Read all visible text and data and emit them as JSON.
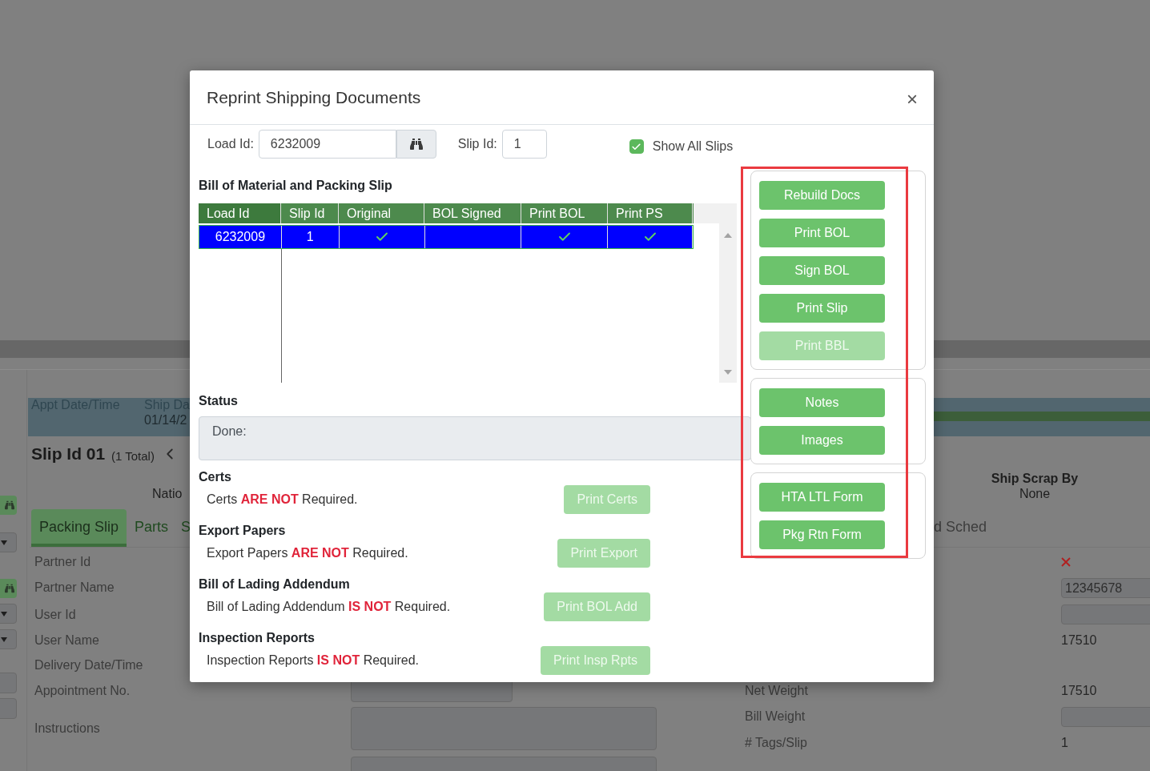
{
  "background": {
    "header_band": [
      {
        "label": "Appt Date/Time"
      },
      {
        "label": "Ship Da",
        "value": "01/14/2"
      }
    ],
    "slip_title": "Slip Id 01",
    "slip_total": "(1 Total)",
    "partial_label": "Natio",
    "tabs": [
      {
        "label": "Packing Slip",
        "selected": true
      },
      {
        "label": "Parts",
        "selected": false
      },
      {
        "label": "S",
        "selected": false
      }
    ],
    "tab_right": "d Sched",
    "ship_scrap": {
      "label": "Ship Scrap By",
      "value": "None"
    },
    "fields": [
      "Partner Id",
      "Partner Name",
      "User Id",
      "User Name",
      "Delivery Date/Time",
      "Appointment No.",
      "Instructions"
    ],
    "right_fields": [
      {
        "kind": "error"
      },
      {
        "kind": "input",
        "value": "12345678"
      },
      {
        "kind": "input"
      },
      {
        "kind": "text",
        "value": "17510"
      }
    ],
    "weights": [
      {
        "label": "Net Weight",
        "kind": "text",
        "value": "17510"
      },
      {
        "label": "Bill Weight",
        "kind": "input"
      },
      {
        "label": "# Tags/Slip",
        "kind": "text",
        "value": "1"
      }
    ]
  },
  "modal": {
    "title": "Reprint Shipping Documents",
    "close": "×",
    "load_id": {
      "label": "Load Id:",
      "value": "6232009"
    },
    "slip_id": {
      "label": "Slip Id:",
      "value": "1"
    },
    "show_all_slips": {
      "label": "Show All Slips",
      "checked": true
    },
    "table": {
      "title": "Bill of Material and Packing Slip",
      "columns": [
        "Load Id",
        "Slip Id",
        "Original",
        "BOL Signed",
        "Print BOL",
        "Print PS"
      ],
      "rows": [
        {
          "load_id": "6232009",
          "slip_id": "1",
          "original": true,
          "bol_signed": false,
          "print_bol": true,
          "print_ps": true,
          "selected": true
        }
      ]
    },
    "status": {
      "title": "Status",
      "text": "Done:"
    },
    "sections": [
      {
        "title": "Certs",
        "text": "Certs **ARE NOT** Required.",
        "button": "Print Certs",
        "disabled": true
      },
      {
        "title": "Export Papers",
        "text": "Export Papers **ARE NOT** Required.",
        "button": "Print Export",
        "disabled": true
      },
      {
        "title": "Bill of Lading Addendum",
        "text": "Bill of Lading Addendum **IS NOT** Required.",
        "button": "Print BOL Add",
        "disabled": true
      },
      {
        "title": "Inspection Reports",
        "text": "Inspection Reports **IS NOT** Required.",
        "button": "Print Insp Rpts",
        "disabled": true
      }
    ],
    "button_groups": [
      [
        {
          "label": "Rebuild Docs",
          "disabled": false
        },
        {
          "label": "Print BOL",
          "disabled": false
        },
        {
          "label": "Sign BOL",
          "disabled": false
        },
        {
          "label": "Print Slip",
          "disabled": false
        },
        {
          "label": "Print BBL",
          "disabled": true
        }
      ],
      [
        {
          "label": "Notes",
          "disabled": false
        },
        {
          "label": "Images",
          "disabled": false
        }
      ],
      [
        {
          "label": "HTA LTL Form",
          "disabled": false
        },
        {
          "label": "Pkg Rtn Form",
          "disabled": false
        }
      ]
    ]
  }
}
